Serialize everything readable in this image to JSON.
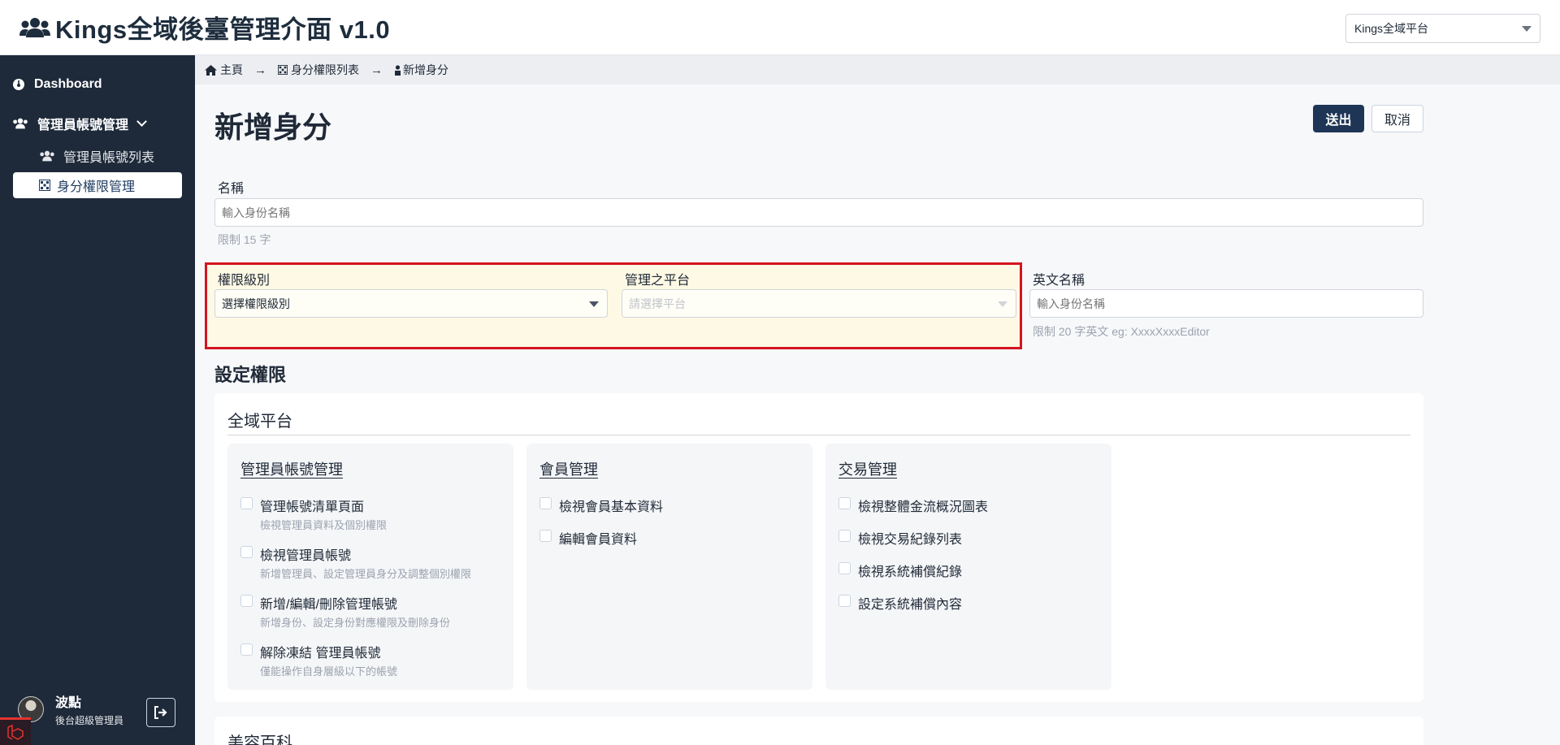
{
  "header": {
    "title": "Kings全域後臺管理介面 v1.0",
    "platform_selected": "Kings全域平台"
  },
  "sidebar": {
    "dashboard": "Dashboard",
    "admin_group": "管理員帳號管理",
    "sub_items": [
      "管理員帳號列表",
      "身分權限管理"
    ],
    "user_name": "波點",
    "user_role": "後台超級管理員"
  },
  "breadcrumb": [
    "主頁",
    "身分權限列表",
    "新增身分"
  ],
  "page": {
    "title": "新增身分",
    "submit": "送出",
    "cancel": "取消"
  },
  "form": {
    "name_label": "名稱",
    "name_placeholder": "輸入身份名稱",
    "name_hint": "限制 15 字",
    "level_label": "權限級別",
    "level_value": "選擇權限級別",
    "platform_label": "管理之平台",
    "platform_placeholder": "請選擇平台",
    "en_label": "英文名稱",
    "en_placeholder": "輸入身份名稱",
    "en_hint": "限制 20 字英文 eg: XxxxXxxxEditor"
  },
  "permissions": {
    "section_title": "設定權限",
    "platform_title": "全域平台",
    "groups": [
      {
        "title": "管理員帳號管理",
        "items": [
          {
            "label": "管理帳號清單頁面",
            "desc": "檢視管理員資料及個別權限"
          },
          {
            "label": "檢視管理員帳號",
            "desc": "新增管理員、設定管理員身分及調整個別權限"
          },
          {
            "label": "新增/編輯/刪除管理帳號",
            "desc": "新增身份、設定身份對應權限及刪除身份"
          },
          {
            "label": "解除凍結 管理員帳號",
            "desc": "僅能操作自身層級以下的帳號"
          }
        ]
      },
      {
        "title": "會員管理",
        "items": [
          {
            "label": "檢視會員基本資料",
            "desc": ""
          },
          {
            "label": "編輯會員資料",
            "desc": ""
          }
        ]
      },
      {
        "title": "交易管理",
        "items": [
          {
            "label": "檢視整體金流概況圖表",
            "desc": ""
          },
          {
            "label": "檢視交易紀錄列表",
            "desc": ""
          },
          {
            "label": "檢視系統補償紀錄",
            "desc": ""
          },
          {
            "label": "設定系統補償內容",
            "desc": ""
          }
        ]
      }
    ],
    "next_platform_title": "美容百科"
  },
  "colors": {
    "sidebar_bg": "#1e2a3a",
    "primary_button": "#1e3556",
    "highlight_border": "#d3151f",
    "highlight_fill": "#fdf9e4"
  }
}
